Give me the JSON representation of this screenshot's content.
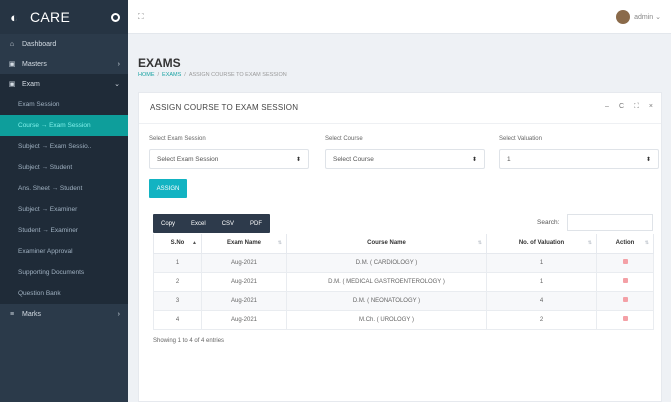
{
  "app": {
    "name": "CARE"
  },
  "sidebar": {
    "items": [
      {
        "label": "Dashboard",
        "icon": "home-icon"
      },
      {
        "label": "Masters",
        "icon": "folder-icon",
        "chevron": "›"
      },
      {
        "label": "Exam",
        "icon": "folder-icon",
        "chevron": "⌄"
      },
      {
        "label": "Marks",
        "icon": "list-icon",
        "chevron": "›"
      }
    ],
    "exam_sub": [
      "Exam Session",
      "Course → Exam Session",
      "Subject → Exam Sessio..",
      "Subject → Student",
      "Ans. Sheet → Student",
      "Subject → Examiner",
      "Student → Examiner",
      "Examiner Approval",
      "Supporting Documents",
      "Question Bank"
    ]
  },
  "topbar": {
    "expand_glyph": "⛶",
    "user": "admin",
    "user_chevron": "⌄"
  },
  "page": {
    "title": "EXAMS",
    "breadcrumb": [
      "HOME",
      "/",
      "EXAMS",
      "/",
      "ASSIGN COURSE TO EXAM SESSION"
    ]
  },
  "card": {
    "title": "ASSIGN COURSE TO EXAM SESSION",
    "tools": [
      "–",
      "C",
      "⛶",
      "×"
    ],
    "form": {
      "session_label": "Select Exam Session",
      "session_value": "Select Exam Session",
      "course_label": "Select Course",
      "course_value": "Select Course",
      "valuation_label": "Select Valuation",
      "valuation_value": "1",
      "arrow": "⬍"
    },
    "assign_label": "ASSIGN",
    "export": [
      "Copy",
      "Excel",
      "CSV",
      "PDF"
    ],
    "search_label": "Search:",
    "table": {
      "headers": [
        "S.No",
        "Exam Name",
        "Course Name",
        "No. of Valuation",
        "Action"
      ],
      "rows": [
        [
          "1",
          "Aug-2021",
          "D.M. ( CARDIOLOGY )",
          "1"
        ],
        [
          "2",
          "Aug-2021",
          "D.M. ( MEDICAL GASTROENTEROLOGY )",
          "1"
        ],
        [
          "3",
          "Aug-2021",
          "D.M. ( NEONATOLOGY )",
          "4"
        ],
        [
          "4",
          "Aug-2021",
          "M.Ch. ( UROLOGY )",
          "2"
        ]
      ]
    },
    "info": "Showing 1 to 4 of 4 entries"
  },
  "colors": {
    "sidebar": "#2b3a4a",
    "accent": "#12b3c2",
    "active": "#0e9e9b",
    "delete": "#f4a0a6"
  }
}
